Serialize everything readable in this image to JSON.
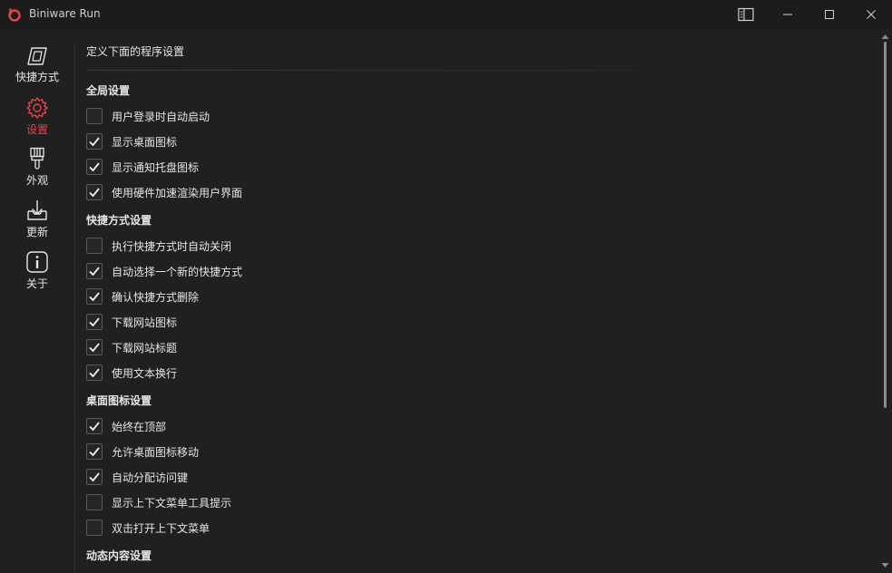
{
  "window": {
    "title": "Biniware Run",
    "accent": "#e8424f"
  },
  "sidebar": {
    "items": [
      {
        "label": "快捷方式",
        "icon": "shortcut-icon",
        "active": false
      },
      {
        "label": "设置",
        "icon": "gear-icon",
        "active": true
      },
      {
        "label": "外观",
        "icon": "brush-icon",
        "active": false
      },
      {
        "label": "更新",
        "icon": "download-icon",
        "active": false
      },
      {
        "label": "关于",
        "icon": "info-icon",
        "active": false
      }
    ]
  },
  "main": {
    "heading": "定义下面的程序设置",
    "sections": [
      {
        "title": "全局设置",
        "options": [
          {
            "label": "用户登录时自动启动",
            "checked": false
          },
          {
            "label": "显示桌面图标",
            "checked": true
          },
          {
            "label": "显示通知托盘图标",
            "checked": true
          },
          {
            "label": "使用硬件加速渲染用户界面",
            "checked": true
          }
        ]
      },
      {
        "title": "快捷方式设置",
        "options": [
          {
            "label": "执行快捷方式时自动关闭",
            "checked": false
          },
          {
            "label": "自动选择一个新的快捷方式",
            "checked": true
          },
          {
            "label": "确认快捷方式删除",
            "checked": true
          },
          {
            "label": "下载网站图标",
            "checked": true
          },
          {
            "label": "下载网站标题",
            "checked": true
          },
          {
            "label": "使用文本换行",
            "checked": true
          }
        ]
      },
      {
        "title": "桌面图标设置",
        "options": [
          {
            "label": "始终在顶部",
            "checked": true
          },
          {
            "label": "允许桌面图标移动",
            "checked": true
          },
          {
            "label": "自动分配访问键",
            "checked": true
          },
          {
            "label": "显示上下文菜单工具提示",
            "checked": false
          },
          {
            "label": "双击打开上下文菜单",
            "checked": false
          }
        ]
      },
      {
        "title": "动态内容设置",
        "options": []
      }
    ]
  }
}
